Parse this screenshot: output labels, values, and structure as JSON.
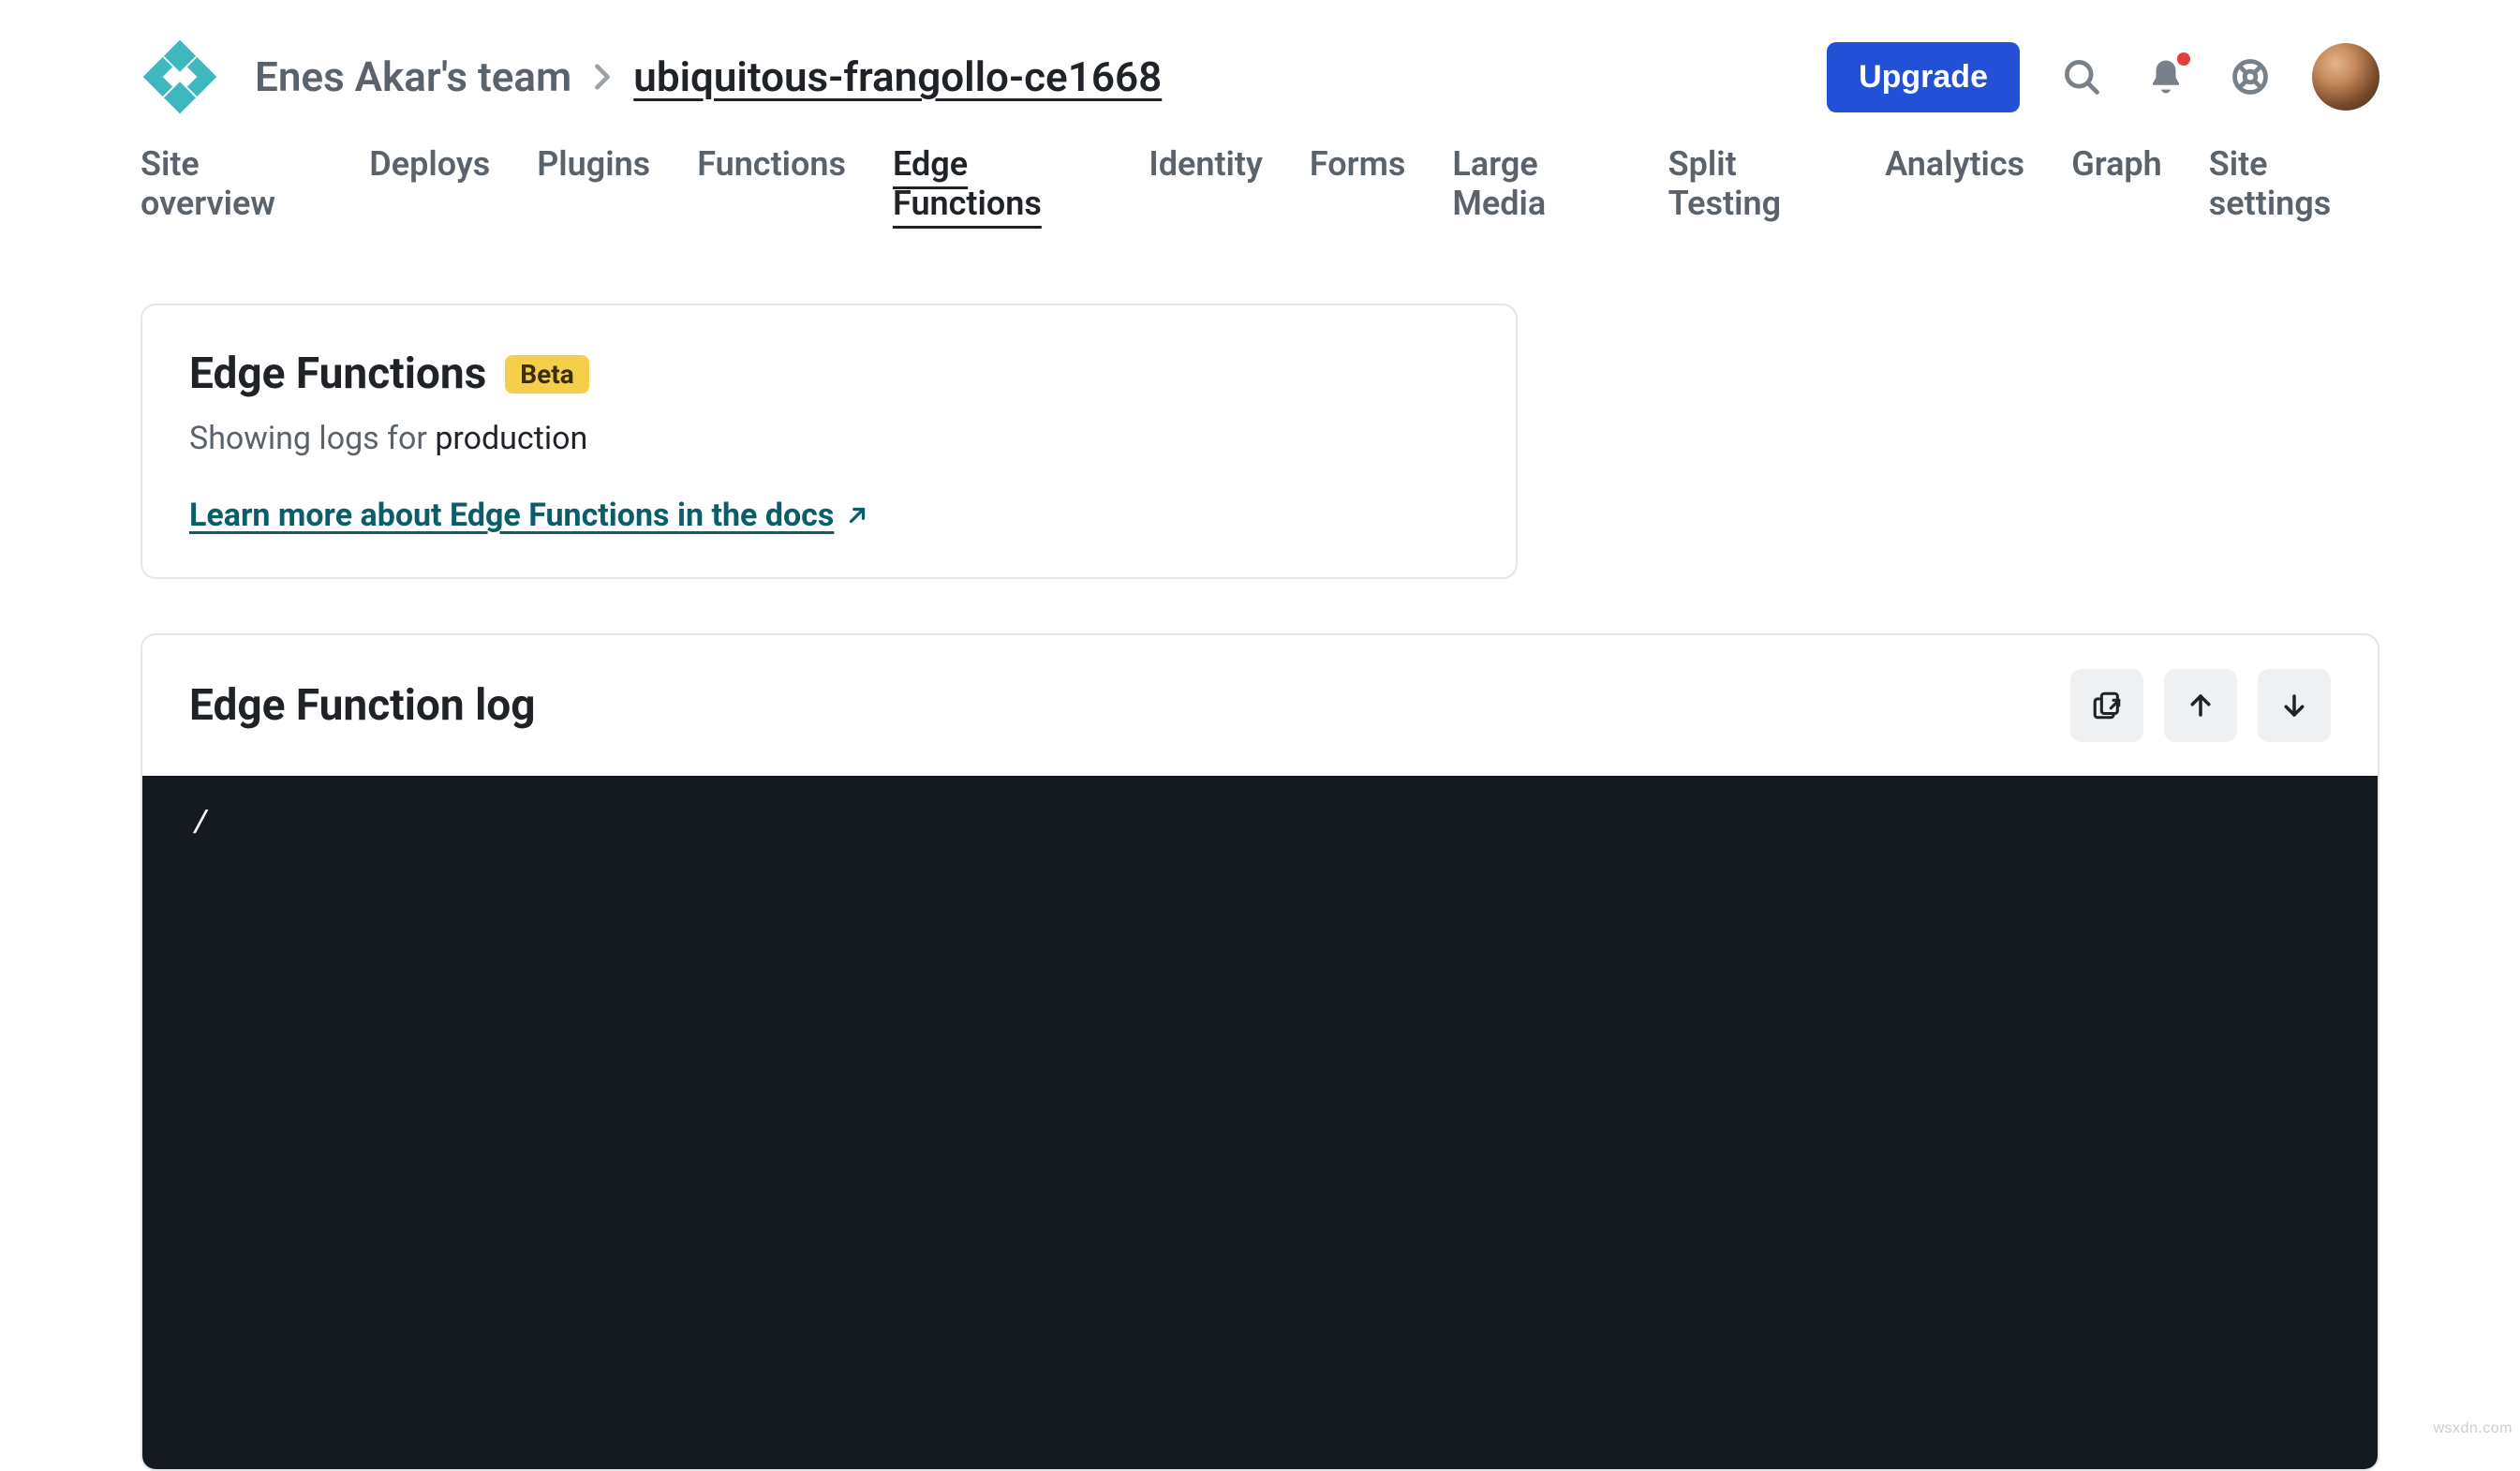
{
  "header": {
    "team_label": "Enes Akar's team",
    "site_label": "ubiquitous-frangollo-ce1668",
    "upgrade_label": "Upgrade"
  },
  "nav": {
    "tabs": [
      {
        "label": "Site overview",
        "active": false
      },
      {
        "label": "Deploys",
        "active": false
      },
      {
        "label": "Plugins",
        "active": false
      },
      {
        "label": "Functions",
        "active": false
      },
      {
        "label": "Edge Functions",
        "active": true
      },
      {
        "label": "Identity",
        "active": false
      },
      {
        "label": "Forms",
        "active": false
      },
      {
        "label": "Large Media",
        "active": false
      },
      {
        "label": "Split Testing",
        "active": false
      },
      {
        "label": "Analytics",
        "active": false
      },
      {
        "label": "Graph",
        "active": false
      },
      {
        "label": "Site settings",
        "active": false
      }
    ]
  },
  "info_card": {
    "title": "Edge Functions",
    "badge": "Beta",
    "showing_prefix": "Showing logs for ",
    "showing_strong": "production",
    "docs_link": "Learn more about Edge Functions in the docs"
  },
  "log_panel": {
    "title": "Edge Function log",
    "content": "/"
  },
  "watermark": "wsxdn.com"
}
